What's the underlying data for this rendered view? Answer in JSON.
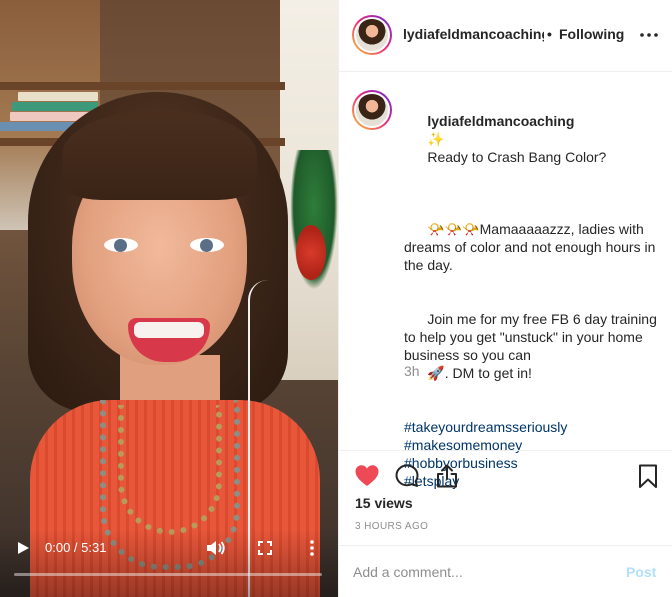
{
  "video": {
    "current_time": "0:00",
    "duration": "5:31",
    "time_display": "0:00 / 5:31",
    "progress": 0.0,
    "icons": [
      "play-icon",
      "volume-icon",
      "fullscreen-icon",
      "more-vertical-icon"
    ]
  },
  "header": {
    "username": "lydiafeldmancoaching",
    "separator": "•",
    "follow_status": "Following",
    "more_icon": "more-horizontal-icon"
  },
  "caption": {
    "username": "lydiafeldmancoaching",
    "sparkle": "✨",
    "line1": "Ready to Crash Bang Color?",
    "horns": "📯📯📯",
    "para1": "Mamaaaaazzz, ladies with dreams of color and not enough hours in the day.",
    "para2a": "Join me for my free FB 6 day training to help you get \"unstuck\" in your home business so you can",
    "rocket": "🚀",
    "para2b": ". DM to get in!",
    "hashtags": [
      "#takeyourdreamsseriously",
      "#makesomemoney",
      "#hobbyorbusiness",
      "#letsplay"
    ],
    "age": "3h"
  },
  "actions": {
    "like_icon": "heart-filled-icon",
    "comment_icon": "comment-icon",
    "share_icon": "share-icon",
    "save_icon": "bookmark-icon",
    "liked": true,
    "like_color": "#ed4956",
    "views": "15 views",
    "timestamp": "3 HOURS AGO"
  },
  "comment": {
    "placeholder": "Add a comment...",
    "post_label": "Post"
  }
}
